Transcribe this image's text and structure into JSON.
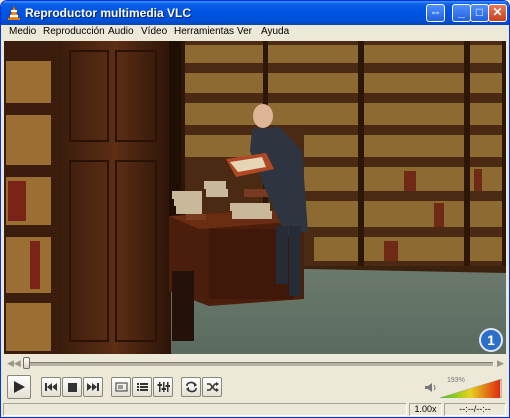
{
  "window": {
    "title": "Reproductor multimedia VLC",
    "buttons": {
      "extra": "⇔",
      "minimize": "_",
      "maximize": "□",
      "close": "✕"
    }
  },
  "menu": [
    "Medio",
    "Reproducción",
    "Audio",
    "Vídeo",
    "Herramientas",
    "Ver",
    "Ayuda"
  ],
  "video": {
    "channel_logo": "1",
    "description": "library bookcases with man reading book at desk"
  },
  "seek": {
    "position_fraction": 0.0
  },
  "controls": {
    "icons": [
      "play-icon",
      "previous-icon",
      "stop-icon",
      "next-icon",
      "fullscreen-icon",
      "playlist-icon",
      "extended-settings-icon",
      "loop-icon",
      "random-icon"
    ],
    "volume": {
      "percent_label": "193%",
      "level_fraction": 0.97,
      "icon": "speaker-icon"
    }
  },
  "status": {
    "speed": "1.00x",
    "time": "--:--/--:--"
  },
  "colors": {
    "title_bar": "#0054e3",
    "window_bg": "#ece9d8"
  }
}
